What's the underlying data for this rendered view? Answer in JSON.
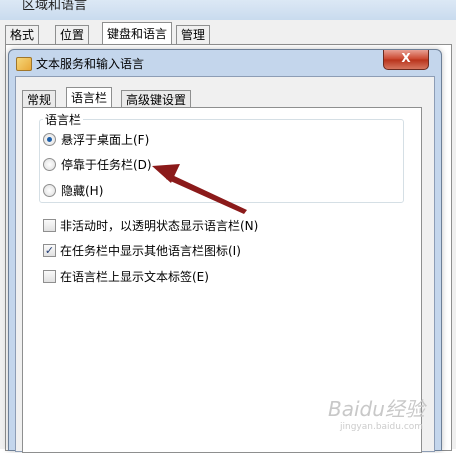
{
  "outer": {
    "title": "区域和语言",
    "tabs": [
      "格式",
      "位置",
      "键盘和语言",
      "管理"
    ],
    "active_tab": 2
  },
  "dialog": {
    "title": "文本服务和输入语言",
    "close_label": "X",
    "tabs": [
      "常规",
      "语言栏",
      "高级键设置"
    ],
    "active_tab": 1
  },
  "language_bar": {
    "group_label": "语言栏",
    "options": [
      {
        "label": "悬浮于桌面上(F)",
        "selected": true
      },
      {
        "label": "停靠于任务栏(D)",
        "selected": false
      },
      {
        "label": "隐藏(H)",
        "selected": false
      }
    ]
  },
  "checkboxes": [
    {
      "label": "非活动时，以透明状态显示语言栏(N)",
      "checked": false
    },
    {
      "label": "在任务栏中显示其他语言栏图标(I)",
      "checked": true
    },
    {
      "label": "在语言栏上显示文本标签(E)",
      "checked": false
    }
  ],
  "colors": {
    "arrow": "#8b1a1a",
    "radio_dot": "#1e5fa8",
    "dialog_frame": "#c4d6ec",
    "close_button": "#c9432a"
  },
  "watermark": {
    "text": "Baidu经验",
    "sub": "jingyan.baidu.com"
  }
}
